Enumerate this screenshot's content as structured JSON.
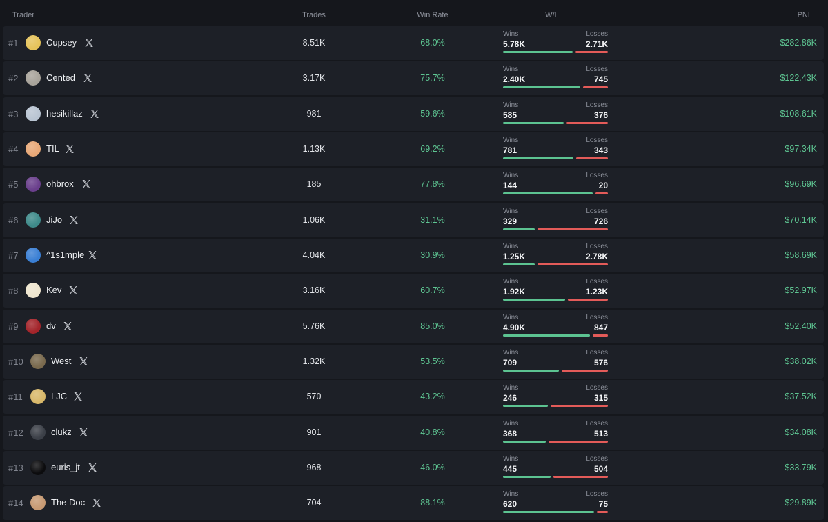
{
  "header": {
    "trader": "Trader",
    "trades": "Trades",
    "win_rate": "Win Rate",
    "wl": "W/L",
    "pnl": "PNL"
  },
  "labels": {
    "wins": "Wins",
    "losses": "Losses"
  },
  "colors": {
    "background": "#15171c",
    "row": "#1d2027",
    "positive": "#5ec592",
    "negative": "#e35b59"
  },
  "traders": [
    {
      "rank": "#1",
      "name": "Cupsey",
      "avatar_color": "#e5c35a",
      "trades": "8.51K",
      "win_rate": "68.0%",
      "wins": "5.78K",
      "losses": "2.71K",
      "win_fraction": 0.68,
      "pnl": "$282.86K"
    },
    {
      "rank": "#2",
      "name": "Cented",
      "avatar_color": "#a8a39a",
      "trades": "3.17K",
      "win_rate": "75.7%",
      "wins": "2.40K",
      "losses": "745",
      "win_fraction": 0.757,
      "pnl": "$122.43K"
    },
    {
      "rank": "#3",
      "name": "hesikillaz",
      "avatar_color": "#b9c4d2",
      "trades": "981",
      "win_rate": "59.6%",
      "wins": "585",
      "losses": "376",
      "win_fraction": 0.596,
      "pnl": "$108.61K"
    },
    {
      "rank": "#4",
      "name": "TIL",
      "avatar_color": "#e8a877",
      "trades": "1.13K",
      "win_rate": "69.2%",
      "wins": "781",
      "losses": "343",
      "win_fraction": 0.692,
      "pnl": "$97.34K"
    },
    {
      "rank": "#5",
      "name": "ohbrox",
      "avatar_color": "#6a3f8c",
      "trades": "185",
      "win_rate": "77.8%",
      "wins": "144",
      "losses": "20",
      "win_fraction": 0.878,
      "pnl": "$96.69K"
    },
    {
      "rank": "#6",
      "name": "JiJo",
      "avatar_color": "#3e8a8a",
      "trades": "1.06K",
      "win_rate": "31.1%",
      "wins": "329",
      "losses": "726",
      "win_fraction": 0.311,
      "pnl": "$70.14K"
    },
    {
      "rank": "#7",
      "name": "^1s1mple",
      "avatar_color": "#3a7fd4",
      "trades": "4.04K",
      "win_rate": "30.9%",
      "wins": "1.25K",
      "losses": "2.78K",
      "win_fraction": 0.309,
      "pnl": "$58.69K"
    },
    {
      "rank": "#8",
      "name": "Kev",
      "avatar_color": "#efe6cf",
      "trades": "3.16K",
      "win_rate": "60.7%",
      "wins": "1.92K",
      "losses": "1.23K",
      "win_fraction": 0.607,
      "pnl": "$52.97K"
    },
    {
      "rank": "#9",
      "name": "dv",
      "avatar_color": "#a3242a",
      "trades": "5.76K",
      "win_rate": "85.0%",
      "wins": "4.90K",
      "losses": "847",
      "win_fraction": 0.85,
      "pnl": "$52.40K"
    },
    {
      "rank": "#10",
      "name": "West",
      "avatar_color": "#7a6a4e",
      "trades": "1.32K",
      "win_rate": "53.5%",
      "wins": "709",
      "losses": "576",
      "win_fraction": 0.55,
      "pnl": "$38.02K"
    },
    {
      "rank": "#11",
      "name": "LJC",
      "avatar_color": "#d8b86a",
      "trades": "570",
      "win_rate": "43.2%",
      "wins": "246",
      "losses": "315",
      "win_fraction": 0.438,
      "pnl": "$37.52K"
    },
    {
      "rank": "#12",
      "name": "clukz",
      "avatar_color": "#3c4048",
      "trades": "901",
      "win_rate": "40.8%",
      "wins": "368",
      "losses": "513",
      "win_fraction": 0.418,
      "pnl": "$34.08K"
    },
    {
      "rank": "#13",
      "name": "euris_jt",
      "avatar_color": "#0c0c0e",
      "trades": "968",
      "win_rate": "46.0%",
      "wins": "445",
      "losses": "504",
      "win_fraction": 0.469,
      "pnl": "$33.79K"
    },
    {
      "rank": "#14",
      "name": "The Doc",
      "avatar_color": "#c79a73",
      "trades": "704",
      "win_rate": "88.1%",
      "wins": "620",
      "losses": "75",
      "win_fraction": 0.892,
      "pnl": "$29.89K"
    }
  ]
}
